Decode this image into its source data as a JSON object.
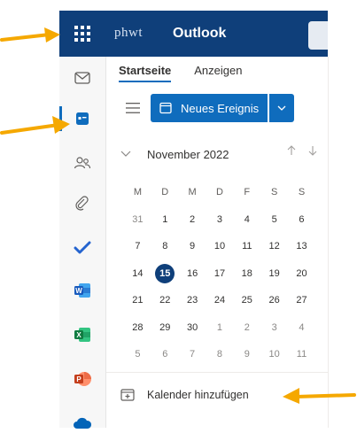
{
  "header": {
    "org_logo": "phwt",
    "org_logo_sub": "",
    "app_title": "Outlook"
  },
  "rail": {
    "items": [
      {
        "name": "mail",
        "icon": "mail-icon"
      },
      {
        "name": "calendar",
        "icon": "calendar-icon",
        "active": true
      },
      {
        "name": "people",
        "icon": "people-icon"
      },
      {
        "name": "files",
        "icon": "attachment-icon"
      },
      {
        "name": "todo",
        "icon": "todo-check-icon"
      },
      {
        "name": "word",
        "icon": "word-icon",
        "letter": "W"
      },
      {
        "name": "excel",
        "icon": "excel-icon",
        "letter": "X"
      },
      {
        "name": "powerpoint",
        "icon": "powerpoint-icon",
        "letter": "P"
      },
      {
        "name": "onedrive",
        "icon": "onedrive-icon"
      }
    ]
  },
  "tabs": [
    {
      "label": "Startseite",
      "active": true
    },
    {
      "label": "Anzeigen",
      "active": false
    }
  ],
  "toolbar": {
    "new_event_label": "Neues Ereignis"
  },
  "calendar": {
    "month_label": "November 2022",
    "weekday_headers": [
      "M",
      "D",
      "M",
      "D",
      "F",
      "S",
      "S"
    ],
    "weeks": [
      [
        "31",
        "1",
        "2",
        "3",
        "4",
        "5",
        "6"
      ],
      [
        "7",
        "8",
        "9",
        "10",
        "11",
        "12",
        "13"
      ],
      [
        "14",
        "15",
        "16",
        "17",
        "18",
        "19",
        "20"
      ],
      [
        "21",
        "22",
        "23",
        "24",
        "25",
        "26",
        "27"
      ],
      [
        "28",
        "29",
        "30",
        "1",
        "2",
        "3",
        "4"
      ],
      [
        "5",
        "6",
        "7",
        "8",
        "9",
        "10",
        "11"
      ]
    ],
    "today": "15"
  },
  "add_calendar_label": "Kalender hinzufügen",
  "colors": {
    "header_bg": "#0f3f7a",
    "accent": "#0f6cbd",
    "arrow": "#f5a800"
  }
}
